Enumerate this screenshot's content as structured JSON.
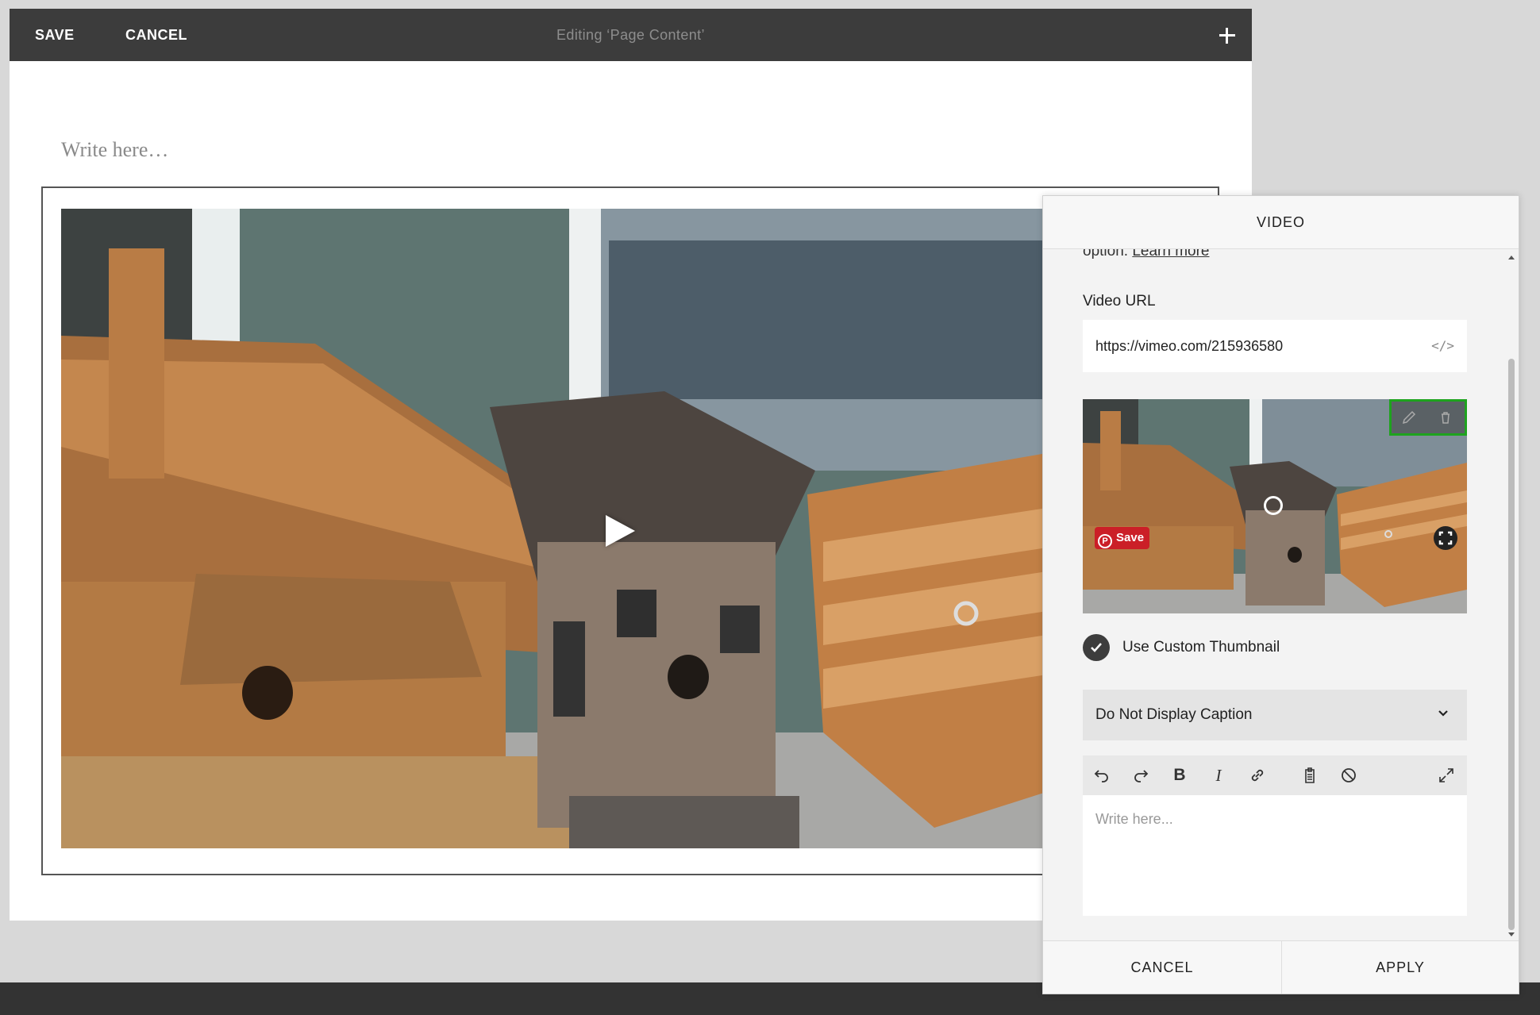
{
  "toolbar": {
    "save": "SAVE",
    "cancel": "CANCEL",
    "title": "Editing ‘Page Content’",
    "add_icon": "plus-icon"
  },
  "editor": {
    "placeholder": "Write here…"
  },
  "video_panel": {
    "title": "VIDEO",
    "intro_text": "option.",
    "learn_more": "Learn more",
    "url_label": "Video URL",
    "url_value": "https://vimeo.com/215936580",
    "embed_icon": "</>",
    "pin_save": "Save",
    "custom_thumbnail_label": "Use Custom Thumbnail",
    "custom_thumbnail_checked": true,
    "caption_select": "Do Not Display Caption",
    "caption_placeholder": "Write here...",
    "cancel": "CANCEL",
    "apply": "APPLY"
  },
  "colors": {
    "toolbar": "#3c3c3c",
    "highlight": "#1ea31e",
    "pinterest": "#cb1f27"
  }
}
